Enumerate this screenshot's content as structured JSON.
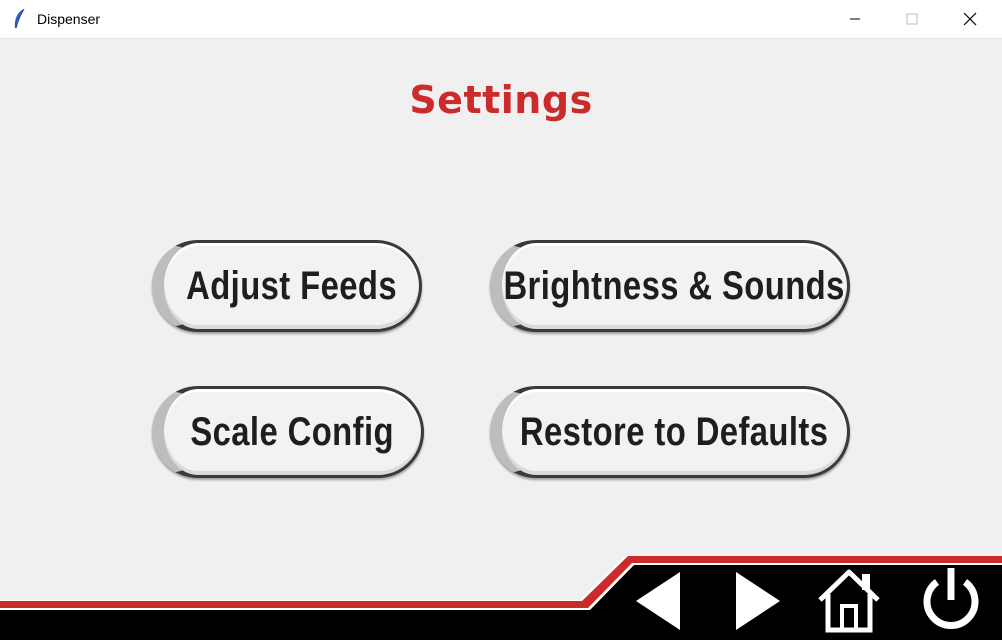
{
  "window": {
    "title": "Dispenser",
    "icon": "feather-icon"
  },
  "page": {
    "title": "Settings"
  },
  "buttons": {
    "adjust_feeds": "Adjust Feeds",
    "brightness_sounds": "Brightness & Sounds",
    "scale_config": "Scale Config",
    "restore_defaults": "Restore to Defaults"
  },
  "nav": {
    "back": "back-arrow-icon",
    "forward": "forward-arrow-icon",
    "home": "home-icon",
    "power": "power-icon"
  },
  "colors": {
    "accent": "#cc2b2b",
    "background": "#f0f0f0",
    "footer": "#000000"
  }
}
